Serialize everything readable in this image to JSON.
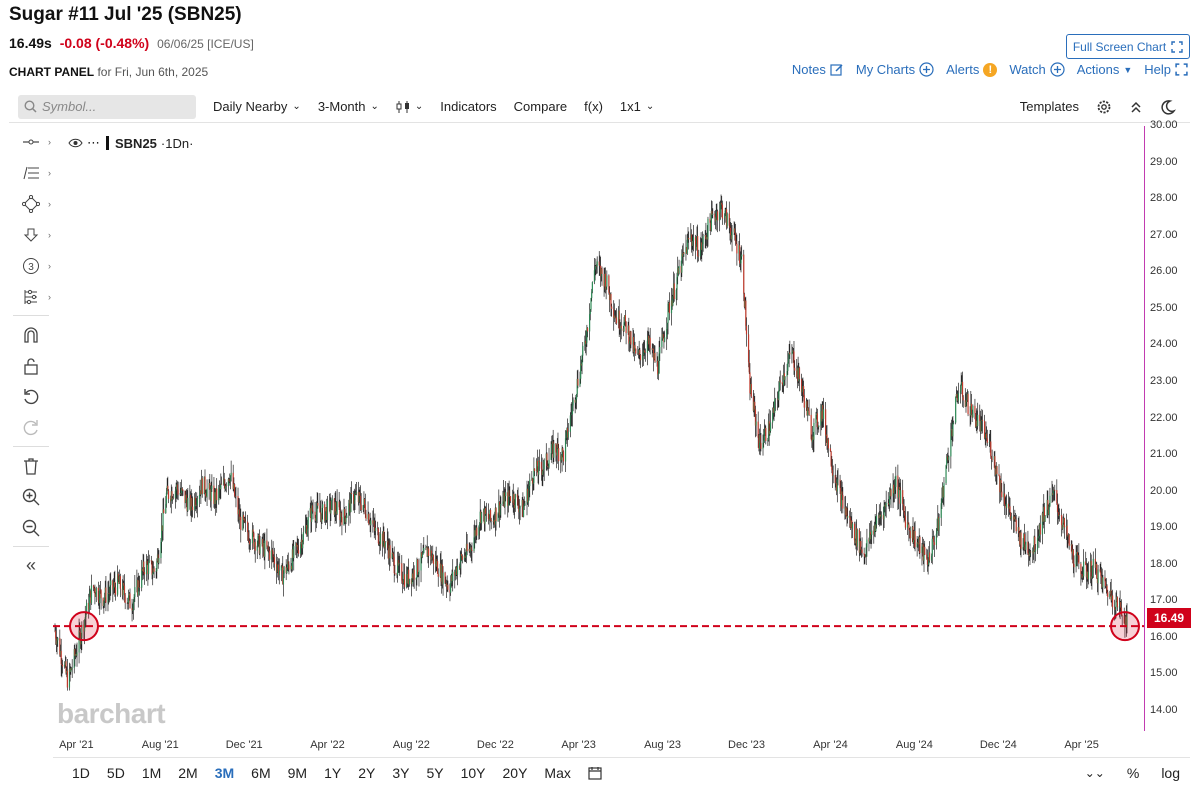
{
  "header": {
    "title": "Sugar #11 Jul '25 (SBN25)",
    "last": "16.49s",
    "change": "-0.08 (-0.48%)",
    "meta": "06/06/25 [ICE/US]",
    "panel_label": "CHART PANEL",
    "panel_date": "for Fri, Jun 6th, 2025",
    "fullscreen": "Full Screen Chart",
    "links": {
      "notes": "Notes",
      "mycharts": "My Charts",
      "alerts": "Alerts",
      "alert_badge": "!",
      "watch": "Watch",
      "actions": "Actions",
      "help": "Help"
    }
  },
  "toolbar": {
    "search_placeholder": "Symbol...",
    "period": "Daily Nearby",
    "range": "3-Month",
    "indicators": "Indicators",
    "compare": "Compare",
    "fx": "f(x)",
    "layout": "1x1",
    "templates": "Templates"
  },
  "legend": {
    "symbol": "SBN25",
    "interval": "·1Dn·"
  },
  "current_price_label": "16.49",
  "watermark": "barchart",
  "bottom": {
    "ranges": [
      "1D",
      "5D",
      "1M",
      "2M",
      "3M",
      "6M",
      "9M",
      "1Y",
      "2Y",
      "3Y",
      "5Y",
      "10Y",
      "20Y",
      "Max"
    ],
    "active": "3M",
    "percent": "%",
    "log": "log"
  },
  "colors": {
    "up": "#2e8b57",
    "down": "#c0392b",
    "accent": "#2a6ebb",
    "price_line": "#d0021b",
    "axis": "#c23bb0"
  },
  "chart_data": {
    "type": "ohlc",
    "symbol": "SBN25",
    "y_ticks": [
      "30.00",
      "29.00",
      "28.00",
      "27.00",
      "26.00",
      "25.00",
      "24.00",
      "23.00",
      "22.00",
      "21.00",
      "20.00",
      "19.00",
      "18.00",
      "17.00",
      "16.00",
      "15.00",
      "14.00"
    ],
    "x_ticks": [
      "Apr '21",
      "Aug '21",
      "Dec '21",
      "Apr '22",
      "Aug '22",
      "Dec '22",
      "Apr '23",
      "Aug '23",
      "Dec '23",
      "Apr '24",
      "Aug '24",
      "Dec '24",
      "Apr '25"
    ],
    "ylim": [
      14,
      30
    ],
    "horizontal_line": 16.32,
    "last_value": 16.49,
    "series": [
      {
        "points": [
          [
            "2021-03-01",
            16.2
          ],
          [
            "2021-03-20",
            14.8
          ],
          [
            "2021-04-10",
            16.3
          ],
          [
            "2021-04-25",
            17.4
          ],
          [
            "2021-05-10",
            17.1
          ],
          [
            "2021-06-01",
            17.5
          ],
          [
            "2021-06-20",
            16.9
          ],
          [
            "2021-07-10",
            18.0
          ],
          [
            "2021-07-25",
            17.8
          ],
          [
            "2021-08-10",
            19.9
          ],
          [
            "2021-08-25",
            20.1
          ],
          [
            "2021-09-15",
            19.6
          ],
          [
            "2021-10-01",
            20.2
          ],
          [
            "2021-10-20",
            19.8
          ],
          [
            "2021-11-10",
            20.5
          ],
          [
            "2021-11-25",
            19.2
          ],
          [
            "2021-12-10",
            18.8
          ],
          [
            "2021-12-25",
            18.5
          ],
          [
            "2022-01-10",
            18.3
          ],
          [
            "2022-01-25",
            17.7
          ],
          [
            "2022-02-10",
            18.2
          ],
          [
            "2022-02-25",
            18.8
          ],
          [
            "2022-03-10",
            19.5
          ],
          [
            "2022-03-25",
            19.4
          ],
          [
            "2022-04-10",
            19.6
          ],
          [
            "2022-04-25",
            19.3
          ],
          [
            "2022-05-10",
            19.9
          ],
          [
            "2022-05-25",
            19.6
          ],
          [
            "2022-06-10",
            18.9
          ],
          [
            "2022-06-25",
            18.6
          ],
          [
            "2022-07-10",
            17.9
          ],
          [
            "2022-07-25",
            17.6
          ],
          [
            "2022-08-10",
            17.9
          ],
          [
            "2022-08-25",
            18.4
          ],
          [
            "2022-09-10",
            17.9
          ],
          [
            "2022-09-25",
            17.4
          ],
          [
            "2022-10-10",
            18.1
          ],
          [
            "2022-10-25",
            18.4
          ],
          [
            "2022-11-10",
            19.4
          ],
          [
            "2022-11-25",
            19.2
          ],
          [
            "2022-12-10",
            19.7
          ],
          [
            "2022-12-25",
            19.9
          ],
          [
            "2023-01-10",
            19.5
          ],
          [
            "2023-01-25",
            20.5
          ],
          [
            "2023-02-10",
            20.7
          ],
          [
            "2023-02-25",
            21.2
          ],
          [
            "2023-03-10",
            21.0
          ],
          [
            "2023-03-25",
            22.5
          ],
          [
            "2023-04-10",
            24.0
          ],
          [
            "2023-04-25",
            26.2
          ],
          [
            "2023-05-10",
            25.8
          ],
          [
            "2023-05-25",
            24.8
          ],
          [
            "2023-06-10",
            24.5
          ],
          [
            "2023-06-25",
            23.6
          ],
          [
            "2023-07-10",
            24.1
          ],
          [
            "2023-07-25",
            23.4
          ],
          [
            "2023-08-10",
            25.0
          ],
          [
            "2023-08-25",
            26.0
          ],
          [
            "2023-09-10",
            27.0
          ],
          [
            "2023-09-25",
            26.6
          ],
          [
            "2023-10-10",
            27.4
          ],
          [
            "2023-10-25",
            27.8
          ],
          [
            "2023-11-10",
            27.1
          ],
          [
            "2023-11-25",
            26.3
          ],
          [
            "2023-12-05",
            23.0
          ],
          [
            "2023-12-20",
            21.3
          ],
          [
            "2024-01-05",
            21.8
          ],
          [
            "2024-01-20",
            23.0
          ],
          [
            "2024-02-05",
            23.8
          ],
          [
            "2024-02-20",
            22.8
          ],
          [
            "2024-03-05",
            21.6
          ],
          [
            "2024-03-20",
            22.2
          ],
          [
            "2024-04-05",
            20.6
          ],
          [
            "2024-04-20",
            19.6
          ],
          [
            "2024-05-05",
            18.9
          ],
          [
            "2024-05-20",
            18.3
          ],
          [
            "2024-06-05",
            19.1
          ],
          [
            "2024-06-20",
            19.6
          ],
          [
            "2024-07-05",
            20.3
          ],
          [
            "2024-07-20",
            19.2
          ],
          [
            "2024-08-05",
            18.6
          ],
          [
            "2024-08-20",
            18.1
          ],
          [
            "2024-09-05",
            19.1
          ],
          [
            "2024-09-20",
            21.2
          ],
          [
            "2024-10-05",
            22.9
          ],
          [
            "2024-10-20",
            22.3
          ],
          [
            "2024-11-05",
            21.8
          ],
          [
            "2024-11-20",
            21.2
          ],
          [
            "2024-12-05",
            20.1
          ],
          [
            "2024-12-20",
            19.3
          ],
          [
            "2025-01-05",
            18.6
          ],
          [
            "2025-01-20",
            18.4
          ],
          [
            "2025-02-05",
            19.4
          ],
          [
            "2025-02-20",
            19.9
          ],
          [
            "2025-03-05",
            19.1
          ],
          [
            "2025-03-20",
            18.2
          ],
          [
            "2025-04-05",
            17.8
          ],
          [
            "2025-04-20",
            17.9
          ],
          [
            "2025-05-05",
            17.4
          ],
          [
            "2025-05-20",
            17.0
          ],
          [
            "2025-06-06",
            16.49
          ]
        ]
      }
    ]
  }
}
